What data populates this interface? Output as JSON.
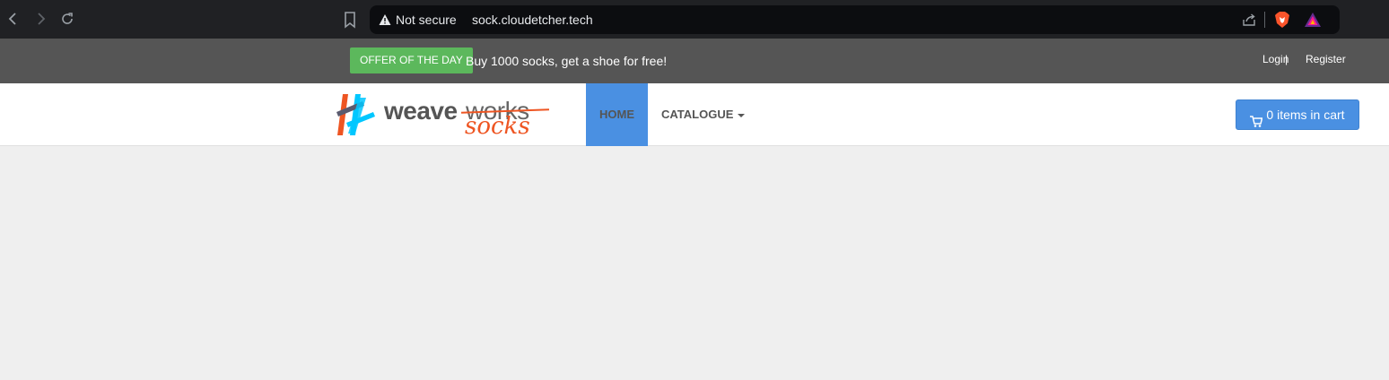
{
  "browser": {
    "security_label": "Not secure",
    "url": "sock.cloudetcher.tech",
    "icons": [
      "back-icon",
      "forward-icon",
      "reload-icon",
      "bookmark-icon",
      "warning-icon",
      "share-icon",
      "brave-shield-icon",
      "brave-rewards-icon"
    ]
  },
  "top_bar": {
    "offer_badge": "OFFER OF THE DAY",
    "offer_text": "Buy 1000 socks, get a shoe for free!",
    "login": "Login",
    "separator": "|",
    "register": "Register"
  },
  "navbar": {
    "logo_word_1": "weave",
    "logo_word_2": "works",
    "logo_word_3": "socks",
    "home": "HOME",
    "catalogue": "CATALOGUE",
    "cart": "0 items in cart"
  },
  "colors": {
    "top_bar": "#555555",
    "offer_badge": "#5cb85c",
    "primary": "#4a90e2",
    "logo_orange": "#ee5522",
    "page_bg": "#efefef"
  }
}
